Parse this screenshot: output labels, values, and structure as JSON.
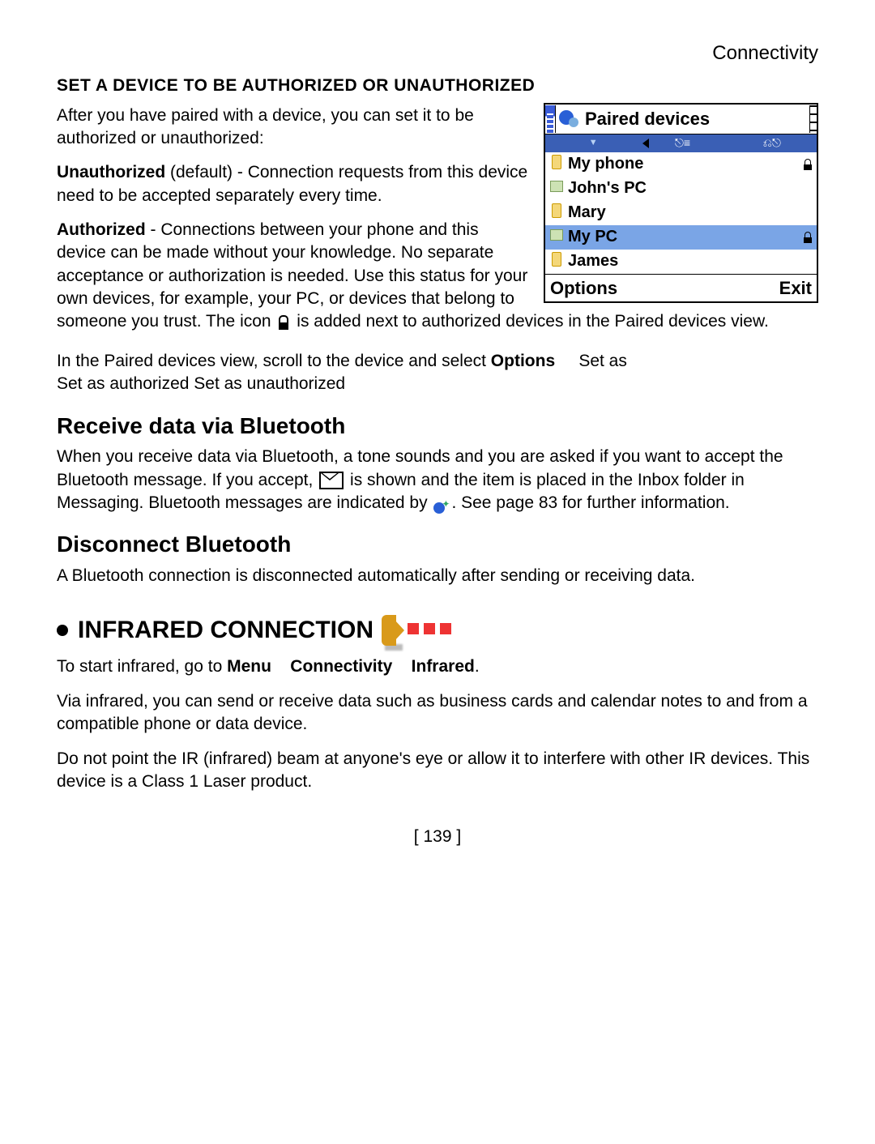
{
  "header": {
    "section": "Connectivity"
  },
  "headings": {
    "authorize": "SET A DEVICE TO BE AUTHORIZED OR UNAUTHORIZED",
    "receive": "Receive data via Bluetooth",
    "disconnect": "Disconnect Bluetooth",
    "infrared": "INFRARED CONNECTION"
  },
  "text": {
    "p1": "After you have paired with a device, you can set it to be authorized or unauthorized:",
    "unauth_label": "Unauthorized",
    "unauth_rest": " (default) - Connection requests from this device need to be accepted separately every time.",
    "auth_label": "Authorized",
    "auth_rest_a": " - Connections between your phone and this device can be made without your knowledge. No separate acceptance or authorization is needed. Use this status for your own devices, for example, your PC, or devices that belong to someone you trust. The icon ",
    "auth_rest_b": " is added next to authorized devices in the Paired devices view.",
    "p4a": "In the Paired devices view, scroll to the device and select ",
    "options_word": "Options",
    "p4b": "Set as authorized",
    "p4c": " Set as unauthorized",
    "setas": "Set as",
    "receive_a": "When you receive data via Bluetooth, a tone sounds and you are asked if you want to accept the Bluetooth message. If you accept, ",
    "receive_b": " is shown and the item is placed in the Inbox folder in Messaging. Bluetooth messages are indicated by ",
    "receive_c": ". See page 83 for further information.",
    "disconnect_p": "A Bluetooth connection is disconnected automatically after sending or receiving data.",
    "ir_start_a": "To start infrared, go to ",
    "ir_menu": "Menu",
    "ir_conn": "Connectivity",
    "ir_infra": "Infrared",
    "ir_period": ".",
    "ir_p2": "Via infrared, you can send or receive data such as business cards and calendar notes to and from a compatible phone or data device.",
    "ir_p3": "Do not point the IR (infrared) beam at anyone's eye or allow it to interfere with other IR devices. This device is a Class 1 Laser product."
  },
  "screenshot": {
    "title": "Paired devices",
    "devices": [
      {
        "name": "My phone",
        "type": "phone",
        "locked": true,
        "selected": false
      },
      {
        "name": "John's PC",
        "type": "pc",
        "locked": false,
        "selected": false
      },
      {
        "name": "Mary",
        "type": "phone",
        "locked": false,
        "selected": false
      },
      {
        "name": "My PC",
        "type": "pc",
        "locked": true,
        "selected": true
      },
      {
        "name": "James",
        "type": "phone",
        "locked": false,
        "selected": false
      }
    ],
    "softkeys": {
      "left": "Options",
      "right": "Exit"
    }
  },
  "page_number": "[ 139 ]"
}
